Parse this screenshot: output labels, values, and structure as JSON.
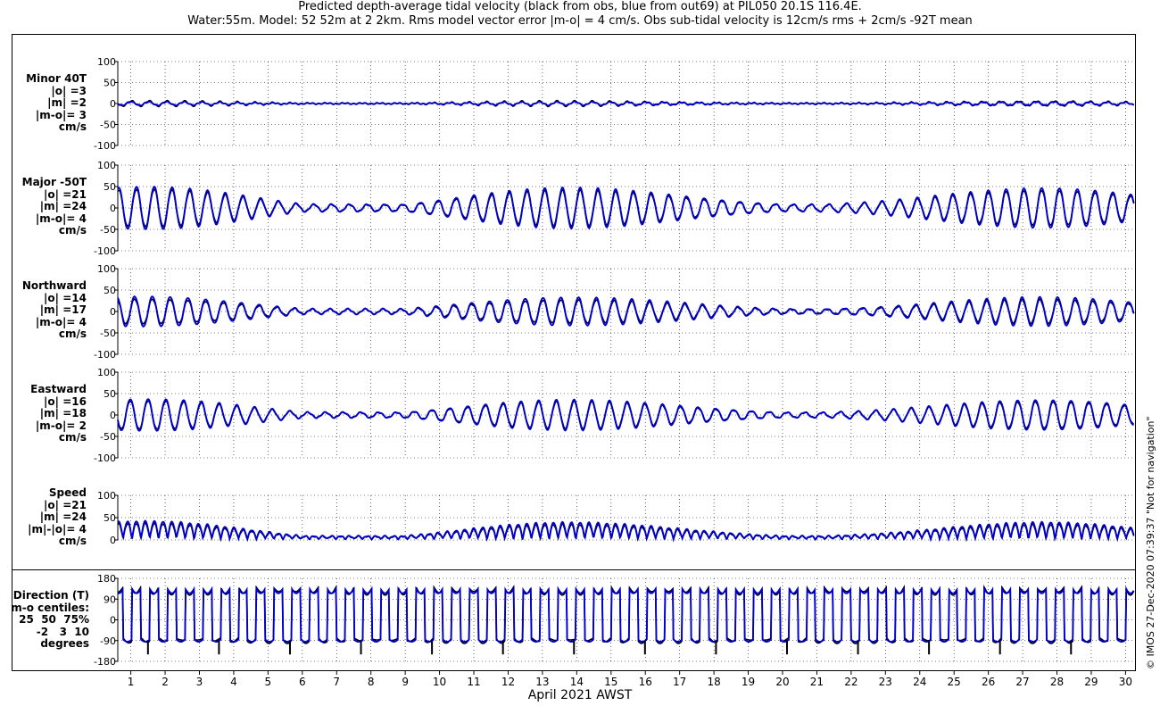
{
  "title": {
    "line1": "Predicted depth-average tidal velocity (black from obs, blue from out69) at PIL050 20.1S 116.4E.",
    "line2": "Water:55m. Model: 52 52m at 2 2km. Rms model vector error |m-o| = 4 cm/s. Obs sub-tidal velocity is 12cm/s rms + 2cm/s -92T mean"
  },
  "xlabel": "April 2021 AWST",
  "credit": "© IMOS 27-Dec-2020 07:39:37  \"Not for navigation\"",
  "colors": {
    "obs": "#000000",
    "model": "#0000cc",
    "grid": "#000000"
  },
  "panels": [
    {
      "lines": [
        "Minor 40T",
        "|o| =3",
        "|m| =2",
        "|m-o|= 3",
        "cm/s"
      ]
    },
    {
      "lines": [
        "Major -50T",
        "|o| =21",
        "|m| =24",
        "|m-o|= 4",
        "cm/s"
      ]
    },
    {
      "lines": [
        "Northward",
        "|o| =14",
        "|m| =17",
        "|m-o|= 4",
        "cm/s"
      ]
    },
    {
      "lines": [
        "Eastward",
        "|o| =16",
        "|m| =18",
        "|m-o|= 2",
        "cm/s"
      ]
    },
    {
      "lines": [
        "Speed",
        "|o| =21",
        "|m| =24",
        "|m|-|o|= 4",
        "cm/s"
      ]
    },
    {
      "lines": [
        "Direction (T)",
        "m-o centiles:",
        "25  50  75%",
        "-2   3  10",
        "degrees"
      ]
    }
  ],
  "chart_data": [
    {
      "type": "line",
      "title": "Minor 40T",
      "ylabel": "cm/s",
      "xlim": [
        0.62,
        30.25
      ],
      "ylim": [
        -100,
        100
      ],
      "yticks": [
        "100",
        "50",
        "0",
        "-50",
        "-100"
      ],
      "xticks": [
        "1",
        "2",
        "3",
        "4",
        "5",
        "6",
        "7",
        "8",
        "9",
        "10",
        "11",
        "12",
        "13",
        "14",
        "15",
        "16",
        "17",
        "18",
        "19",
        "20",
        "21",
        "22",
        "23",
        "24",
        "25",
        "26",
        "27",
        "28",
        "29",
        "30"
      ],
      "series": [
        {
          "amplitude_rms": 3
        },
        {
          "amplitude_rms": 2
        }
      ]
    },
    {
      "type": "line",
      "title": "Major -50T",
      "ylabel": "cm/s",
      "xlim": [
        0.62,
        30.25
      ],
      "ylim": [
        -100,
        100
      ],
      "yticks": [
        "100",
        "50",
        "0",
        "-50",
        "-100"
      ],
      "series": [
        {
          "amplitude_rms": 21
        },
        {
          "amplitude_rms": 24
        }
      ]
    },
    {
      "type": "line",
      "title": "Northward",
      "ylabel": "cm/s",
      "xlim": [
        0.62,
        30.25
      ],
      "ylim": [
        -100,
        100
      ],
      "yticks": [
        "100",
        "50",
        "0",
        "-50",
        "-100"
      ],
      "series": [
        {
          "amplitude_rms": 14
        },
        {
          "amplitude_rms": 17
        }
      ]
    },
    {
      "type": "line",
      "title": "Eastward",
      "ylabel": "cm/s",
      "xlim": [
        0.62,
        30.25
      ],
      "ylim": [
        -100,
        100
      ],
      "yticks": [
        "100",
        "50",
        "0",
        "-50",
        "-100"
      ],
      "series": [
        {
          "amplitude_rms": 16
        },
        {
          "amplitude_rms": 18
        }
      ]
    },
    {
      "type": "line",
      "title": "Speed",
      "ylabel": "cm/s",
      "xlim": [
        0.62,
        30.25
      ],
      "ylim": [
        0,
        100
      ],
      "yticks": [
        "100",
        "50",
        "0"
      ],
      "series": [
        {
          "amplitude_rms": 21
        },
        {
          "amplitude_rms": 24
        }
      ]
    },
    {
      "type": "line",
      "title": "Direction (T)",
      "ylabel": "degrees",
      "xlim": [
        0.62,
        30.25
      ],
      "ylim": [
        -180,
        180
      ],
      "yticks": [
        "180",
        "90",
        "0",
        "-90",
        "-180"
      ],
      "series": [
        {},
        {}
      ]
    }
  ],
  "signal": {
    "period_days": 0.5175,
    "neap_days": [
      6.8,
      21.5
    ],
    "spring_days": [
      1.2,
      14.2,
      29.2
    ]
  }
}
